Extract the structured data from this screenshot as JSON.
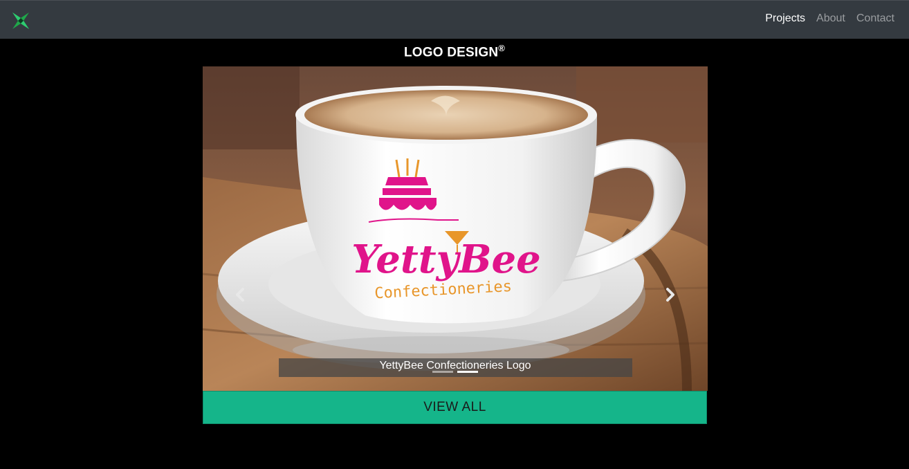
{
  "nav": {
    "brand_icon": "logo-icon",
    "links": [
      {
        "label": "Projects",
        "active": true
      },
      {
        "label": "About",
        "active": false
      },
      {
        "label": "Contact",
        "active": false
      }
    ]
  },
  "section": {
    "title": "LOGO DESIGN",
    "title_mark": "®"
  },
  "carousel": {
    "logo": {
      "name": "YettyBee",
      "sub": "Confectioneries"
    },
    "caption": "YettyBee Confectioneries Logo",
    "indicator_count": 2,
    "active_index": 1,
    "prev_icon": "chevron-left-icon",
    "next_icon": "chevron-right-icon"
  },
  "cta": {
    "label": "VIEW ALL"
  },
  "colors": {
    "navbar": "#343a40",
    "accent": "#15b58a",
    "logo_pink": "#e0148a",
    "logo_orange": "#e8962a"
  }
}
